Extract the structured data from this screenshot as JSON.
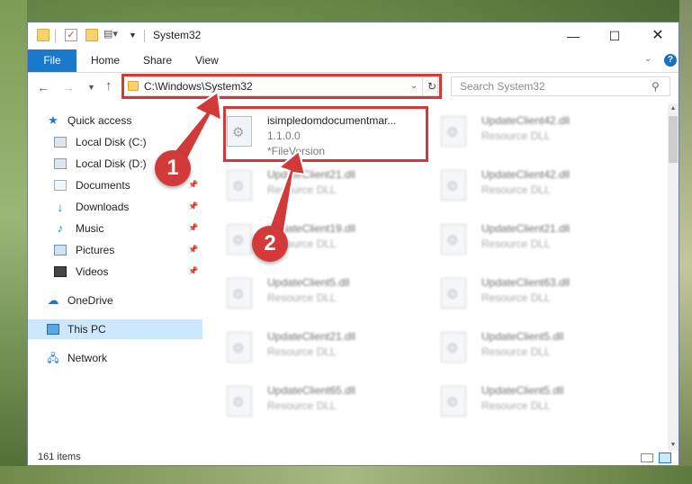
{
  "window": {
    "title": "System32",
    "controls": {
      "minimize": "—",
      "maximize": "☐",
      "close": "✕"
    }
  },
  "ribbon": {
    "tabs": [
      "File",
      "Home",
      "Share",
      "View"
    ],
    "help": "?"
  },
  "navigation": {
    "address": "C:\\Windows\\System32",
    "search_placeholder": "Search System32"
  },
  "sidebar": {
    "items": [
      {
        "label": "Quick access",
        "icon": "star-icon"
      },
      {
        "label": "Local Disk (C:)",
        "icon": "disk-icon"
      },
      {
        "label": "Local Disk (D:)",
        "icon": "disk-icon"
      },
      {
        "label": "Documents",
        "icon": "documents-icon",
        "pinned": true
      },
      {
        "label": "Downloads",
        "icon": "download-icon",
        "pinned": true
      },
      {
        "label": "Music",
        "icon": "music-icon",
        "pinned": true
      },
      {
        "label": "Pictures",
        "icon": "pictures-icon",
        "pinned": true
      },
      {
        "label": "Videos",
        "icon": "videos-icon",
        "pinned": true
      },
      {
        "label": "OneDrive",
        "icon": "cloud-icon"
      },
      {
        "label": "This PC",
        "icon": "computer-icon",
        "selected": true
      },
      {
        "label": "Network",
        "icon": "network-icon"
      }
    ]
  },
  "files": [
    {
      "name": "isimpledomdocumentmar...",
      "version": "1.1.0.0",
      "desc": "*FileVersion"
    },
    {
      "name": "UpdateClient42.dll",
      "desc": "Resource DLL"
    },
    {
      "name": "UpdateClient21.dll",
      "desc": "Resource DLL"
    },
    {
      "name": "UpdateClient42.dll",
      "desc": "Resource DLL"
    },
    {
      "name": "UpdateClient19.dll",
      "desc": "Resource DLL"
    },
    {
      "name": "UpdateClient21.dll",
      "desc": "Resource DLL"
    },
    {
      "name": "UpdateClient5.dll",
      "desc": "Resource DLL"
    },
    {
      "name": "UpdateClient63.dll",
      "desc": "Resource DLL"
    },
    {
      "name": "UpdateClient21.dll",
      "desc": "Resource DLL"
    },
    {
      "name": "UpdateClient5.dll",
      "desc": "Resource DLL"
    },
    {
      "name": "UpdateClient65.dll",
      "desc": "Resource DLL"
    },
    {
      "name": "UpdateClient5.dll",
      "desc": "Resource DLL"
    }
  ],
  "status": {
    "item_count": "161 items"
  },
  "annotations": {
    "step1": "1",
    "step2": "2",
    "color": "#d23a3a"
  }
}
